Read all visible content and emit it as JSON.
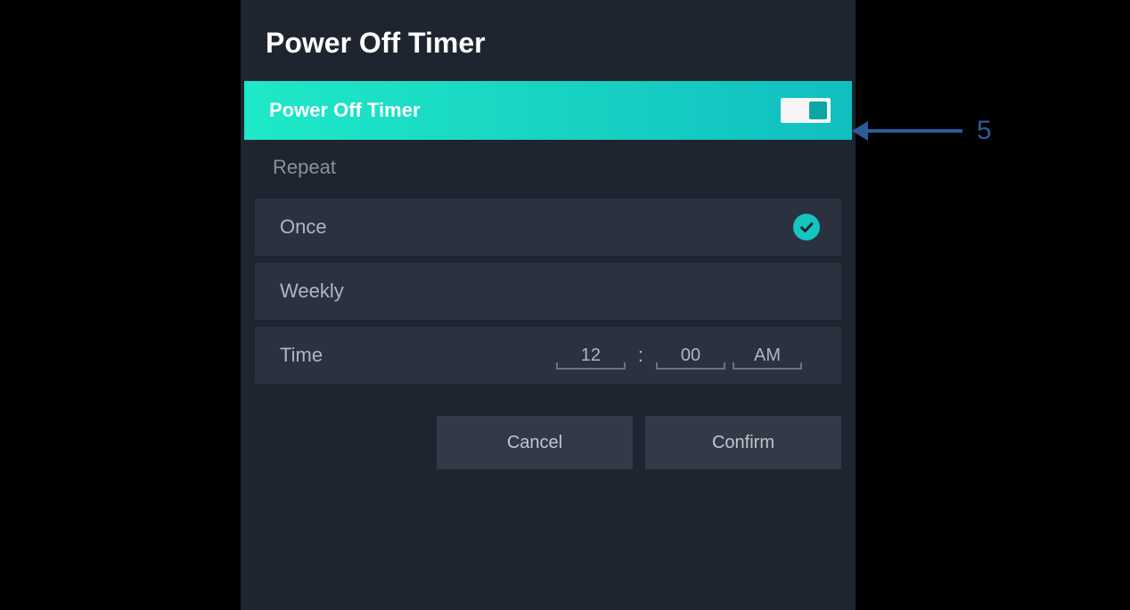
{
  "dialog": {
    "title": "Power Off Timer",
    "toggle": {
      "label": "Power Off Timer",
      "enabled": true
    },
    "repeat": {
      "section_label": "Repeat",
      "options": [
        {
          "label": "Once",
          "selected": true
        },
        {
          "label": "Weekly",
          "selected": false
        }
      ]
    },
    "time": {
      "label": "Time",
      "hour": "12",
      "minute": "00",
      "ampm": "AM"
    },
    "buttons": {
      "cancel": "Cancel",
      "confirm": "Confirm"
    }
  },
  "annotation": {
    "number": "5"
  },
  "colors": {
    "accent": "#14c5c0",
    "highlight_gradient_start": "#1ee9c8",
    "highlight_gradient_end": "#10bfc0",
    "panel_bg": "#1e2530",
    "row_bg": "#2a3240",
    "annotation_blue": "#2a5c9a"
  }
}
